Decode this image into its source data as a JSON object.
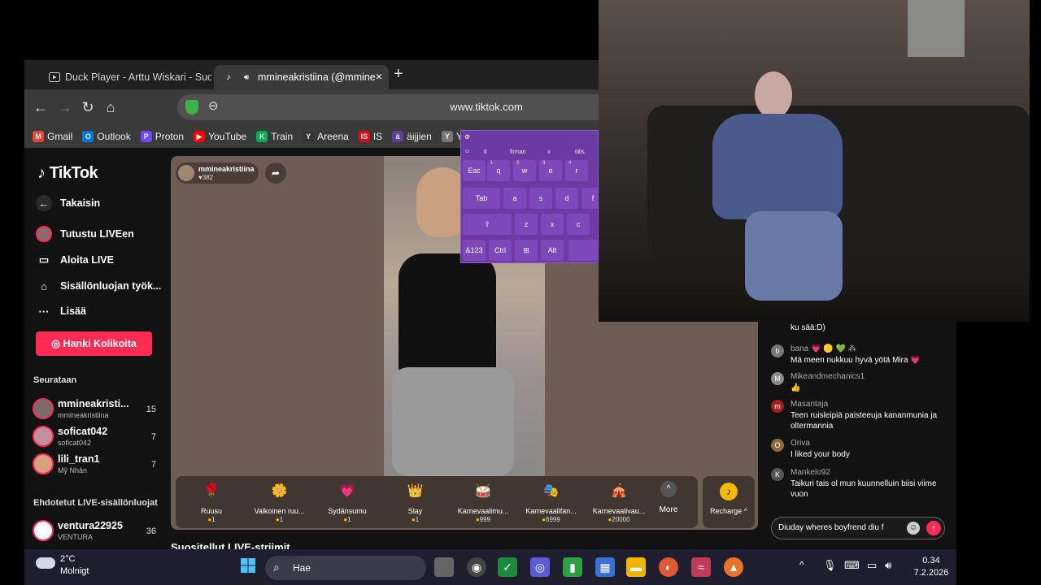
{
  "browser": {
    "tabs": [
      {
        "label": "Duck Player - Arttu Wiskari - Suom",
        "icon": "play-icon",
        "active": false
      },
      {
        "label": "mmineakristiina (@mmine",
        "icon": "tiktok-icon",
        "active": true
      }
    ],
    "new_tab_label": "+",
    "url": "www.tiktok.com",
    "bookmarks": [
      {
        "label": "Gmail",
        "color": "#ea4335",
        "glyph": "M"
      },
      {
        "label": "Outlook",
        "color": "#0078d4",
        "glyph": "O"
      },
      {
        "label": "Proton",
        "color": "#6d4aff",
        "glyph": "P"
      },
      {
        "label": "YouTube",
        "color": "#ff0000",
        "glyph": "▶"
      },
      {
        "label": "Train",
        "color": "#00b050",
        "glyph": "K"
      },
      {
        "label": "Areena",
        "color": "#333333",
        "glyph": "Y"
      },
      {
        "label": "IS",
        "color": "#e30613",
        "glyph": "IS"
      },
      {
        "label": "äijjien",
        "color": "#5a3fa0",
        "glyph": "ä"
      },
      {
        "label": "Yllau",
        "color": "#777777",
        "glyph": "Y"
      }
    ]
  },
  "sidebar": {
    "logo": "TikTok",
    "nav": [
      {
        "label": "Takaisin",
        "icon": "back-arrow-icon"
      },
      {
        "label": "Tutustu LIVEen",
        "icon": "live-avatar-icon"
      },
      {
        "label": "Aloita LIVE",
        "icon": "video-camera-icon"
      },
      {
        "label": "Sisällönluojan työk...",
        "icon": "house-icon"
      },
      {
        "label": "Lisää",
        "icon": "more-dots-icon"
      }
    ],
    "coins_button": "Hanki Kolikoita",
    "following_title": "Seurataan",
    "following": [
      {
        "name": "mmineakristi...",
        "user": "mmineakristiina",
        "count": "15"
      },
      {
        "name": "soficat042",
        "user": "soficat042",
        "count": "7"
      },
      {
        "name": "lili_tran1",
        "user": "Mỹ Nhân",
        "count": "7"
      }
    ],
    "suggested_title": "Ehdotetut LIVE-sisällönluojat",
    "suggested": [
      {
        "name": "ventura22925",
        "user": "VENTURA",
        "count": "36"
      }
    ]
  },
  "stream": {
    "host_name": "mmineakristiina",
    "host_likes": "♥382",
    "gifts": [
      {
        "name": "Ruusu",
        "price": "1",
        "icon": "rose-icon",
        "glyph": "🌹"
      },
      {
        "name": "Valkoinen ruu...",
        "price": "1",
        "icon": "white-rose-icon",
        "glyph": "🌼"
      },
      {
        "name": "Sydänsumu",
        "price": "1",
        "icon": "heart-mist-icon",
        "glyph": "💗"
      },
      {
        "name": "Slay",
        "price": "1",
        "icon": "slay-icon",
        "glyph": "👑"
      },
      {
        "name": "Karnevaalimu...",
        "price": "999",
        "icon": "carnival-music-icon",
        "glyph": "🥁"
      },
      {
        "name": "Karnevaalifan...",
        "price": "6999",
        "icon": "carnival-fan-icon",
        "glyph": "🎭"
      },
      {
        "name": "Karnevaalivau...",
        "price": "20000",
        "icon": "carnival-car-icon",
        "glyph": "🎪"
      }
    ],
    "more_label": "More",
    "recharge_label": "Recharge ^",
    "recommended_title": "Suositellut LIVE-striimit"
  },
  "chat": {
    "top_text": "ku sää:D)",
    "messages": [
      {
        "user": "bana 💗 🟡 💚 ⁂",
        "text": "Mä meen nukkuu hyvä yötä Mira 💗",
        "avatar": "b"
      },
      {
        "user": "Mikeandmechanics1",
        "text": "👍",
        "avatar": "M"
      },
      {
        "user": "Masantaja",
        "text": "Teen ruisleipiä paisteeuja kananmunia ja oltermannia",
        "avatar": "m"
      },
      {
        "user": "Oriva",
        "text": "I liked your body",
        "avatar": "O"
      },
      {
        "user": "Mankelo92",
        "text": "Taikuri tais ol mun kuunnelluin biisi viime vuon",
        "avatar": "K"
      }
    ],
    "input_value": "Diuday wheres boyfrend diu f"
  },
  "keyboard": {
    "suggestions": [
      "tl",
      "firman",
      "x",
      "tiilis"
    ],
    "row1": [
      "Esc",
      "q",
      "w",
      "e",
      "r"
    ],
    "row1_nums": [
      "1",
      "2",
      "3",
      "4"
    ],
    "row2": [
      "Tab",
      "a",
      "s",
      "d",
      "f"
    ],
    "row3": [
      "⇧",
      "z",
      "x",
      "c"
    ],
    "row4": [
      "&123",
      "Ctrl",
      "⊞",
      "Alt"
    ]
  },
  "taskbar": {
    "weather_temp": "2°C",
    "weather_desc": "Molnigt",
    "search_placeholder": "Hae",
    "time": "0.34",
    "date": "7.2.2026"
  }
}
